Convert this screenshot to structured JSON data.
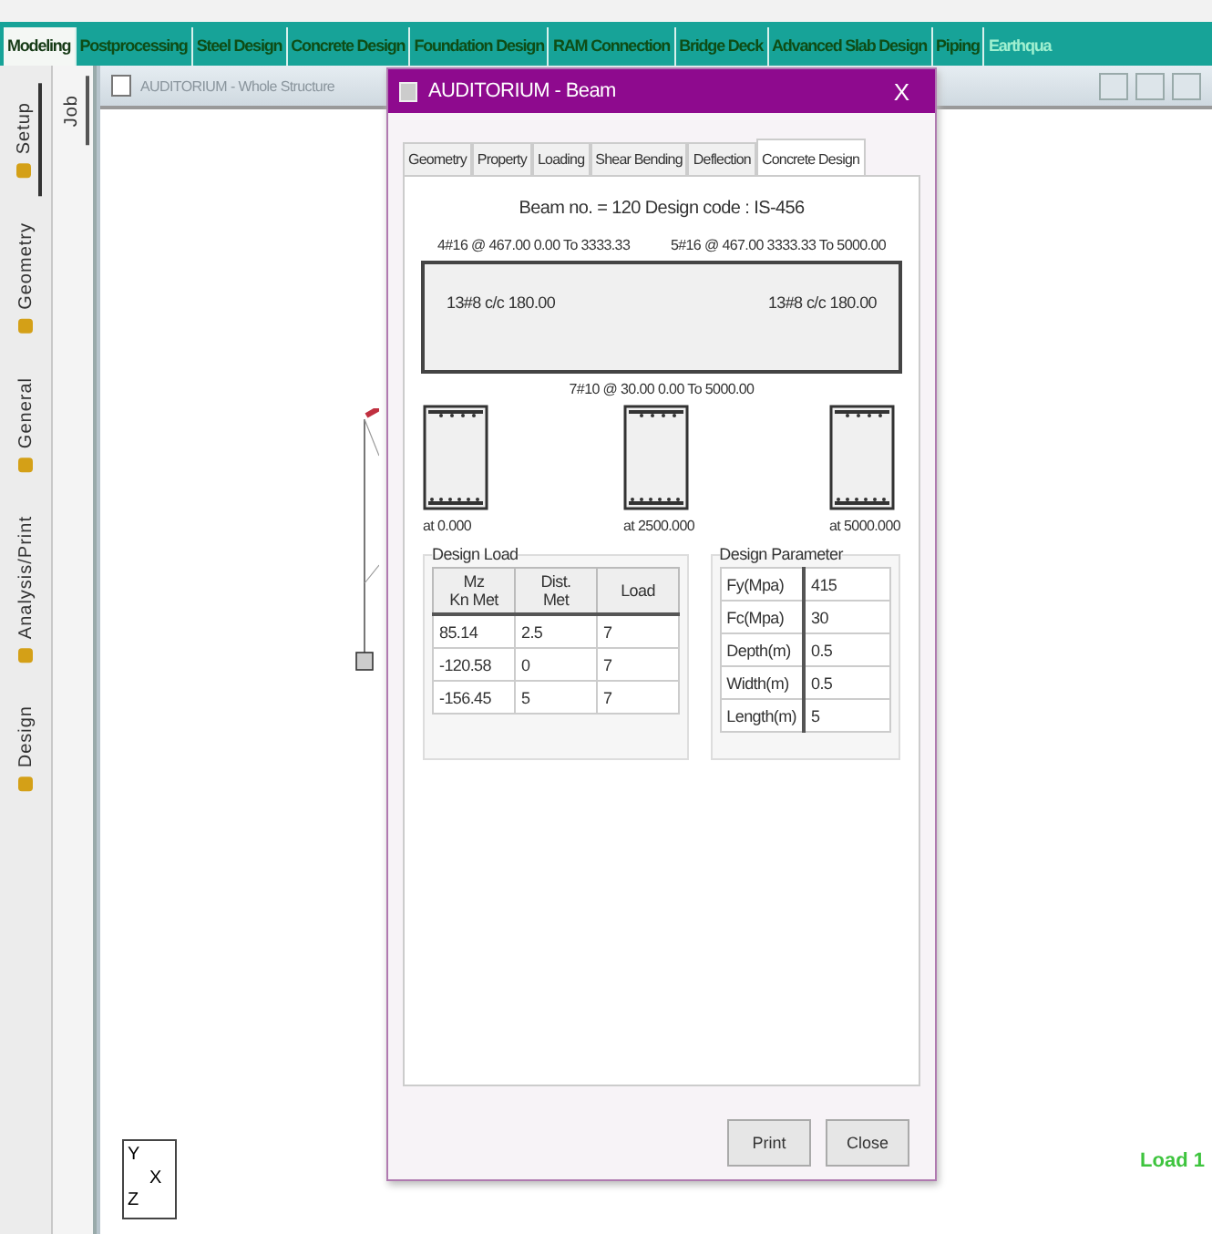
{
  "ribbon_tabs": [
    {
      "label": "Modeling",
      "selected": true
    },
    {
      "label": "Postprocessing",
      "selected": false
    },
    {
      "label": "Steel Design",
      "selected": false
    },
    {
      "label": "Concrete Design",
      "selected": false
    },
    {
      "label": "Foundation Design",
      "selected": false
    },
    {
      "label": "RAM Connection",
      "selected": false
    },
    {
      "label": "Bridge Deck",
      "selected": false
    },
    {
      "label": "Advanced Slab Design",
      "selected": false
    },
    {
      "label": "Piping",
      "selected": false
    },
    {
      "label": "Earthqua",
      "selected": false
    }
  ],
  "side_tabs": [
    {
      "label": "Setup",
      "selected": true
    },
    {
      "label": "Geometry",
      "selected": false
    },
    {
      "label": "General",
      "selected": false
    },
    {
      "label": "Analysis/Print",
      "selected": false
    },
    {
      "label": "Design",
      "selected": false
    }
  ],
  "job_tab": {
    "label": "Job",
    "selected": true
  },
  "structure_window": {
    "title": "AUDITORIUM - Whole Structure",
    "load_label": "Load 1",
    "axis": [
      "Y",
      "X",
      "Z"
    ]
  },
  "dialog": {
    "title": "AUDITORIUM - Beam",
    "close": "X",
    "tabs": [
      {
        "label": "Geometry",
        "selected": false
      },
      {
        "label": "Property",
        "selected": false
      },
      {
        "label": "Loading",
        "selected": false
      },
      {
        "label": "Shear Bending",
        "selected": false
      },
      {
        "label": "Deflection",
        "selected": false
      },
      {
        "label": "Concrete Design",
        "selected": true
      }
    ],
    "heading": "Beam no. = 120  Design code : IS-456",
    "top_bars": [
      "4#16 @ 467.00 0.00 To 3333.33",
      "5#16 @ 467.00 3333.33 To 5000.00"
    ],
    "stirrups": [
      "13#8 c/c 180.00",
      "13#8 c/c 180.00"
    ],
    "bottom_bars": "7#10 @ 30.00 0.00 To 5000.00",
    "sections": [
      "at 0.000",
      "at 2500.000",
      "at 5000.000"
    ],
    "design_load": {
      "title": "Design Load",
      "columns": [
        "Mz\nKn Met",
        "Dist.\nMet",
        "Load"
      ],
      "rows": [
        [
          "85.14",
          "2.5",
          "7"
        ],
        [
          "-120.58",
          "0",
          "7"
        ],
        [
          "-156.45",
          "5",
          "7"
        ]
      ]
    },
    "design_parameter": {
      "title": "Design Parameter",
      "rows": [
        {
          "label": "Fy(Mpa)",
          "value": "415"
        },
        {
          "label": "Fc(Mpa)",
          "value": "30"
        },
        {
          "label": "Depth(m)",
          "value": "0.5"
        },
        {
          "label": "Width(m)",
          "value": "0.5"
        },
        {
          "label": "Length(m)",
          "value": "5"
        }
      ]
    },
    "buttons": [
      "Print",
      "Close"
    ]
  }
}
